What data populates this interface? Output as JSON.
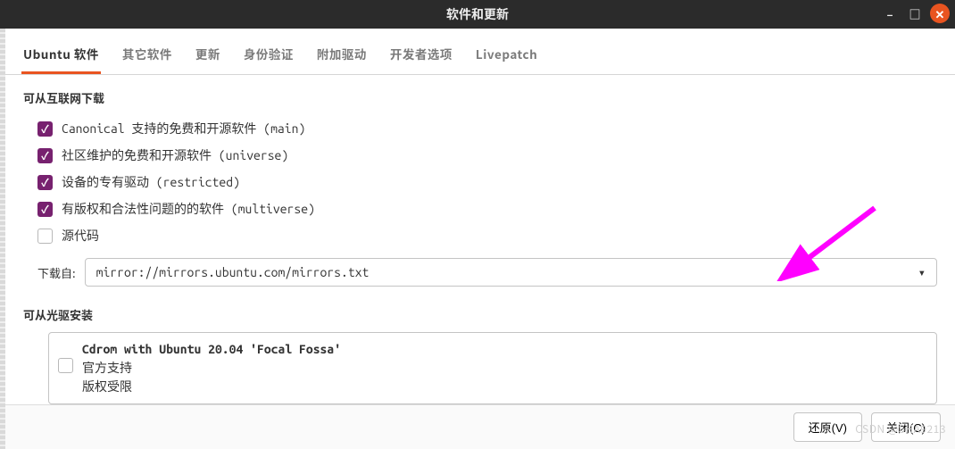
{
  "window": {
    "title": "软件和更新"
  },
  "tabs": {
    "active": "Ubuntu 软件",
    "items": [
      "Ubuntu 软件",
      "其它软件",
      "更新",
      "身份验证",
      "附加驱动",
      "开发者选项",
      "Livepatch"
    ]
  },
  "section_internet": {
    "heading": "可从互联网下载",
    "checks": [
      {
        "label": "Canonical 支持的免费和开源软件 (main)",
        "checked": true
      },
      {
        "label": "社区维护的免费和开源软件 (universe)",
        "checked": true
      },
      {
        "label": "设备的专有驱动 (restricted)",
        "checked": true
      },
      {
        "label": "有版权和合法性问题的的软件 (multiverse)",
        "checked": true
      },
      {
        "label": "源代码",
        "checked": false
      }
    ],
    "download_label": "下载自:",
    "download_value": "mirror://mirrors.ubuntu.com/mirrors.txt"
  },
  "section_cdrom": {
    "heading": "可从光驱安装",
    "entry": {
      "title": "Cdrom with Ubuntu 20.04 'Focal Fossa'",
      "line1": "官方支持",
      "line2": "版权受限",
      "checked": false
    }
  },
  "footer": {
    "revert": "还原(V)",
    "close": "关闭(C)"
  },
  "watermark": "CSDN @SHA9213"
}
